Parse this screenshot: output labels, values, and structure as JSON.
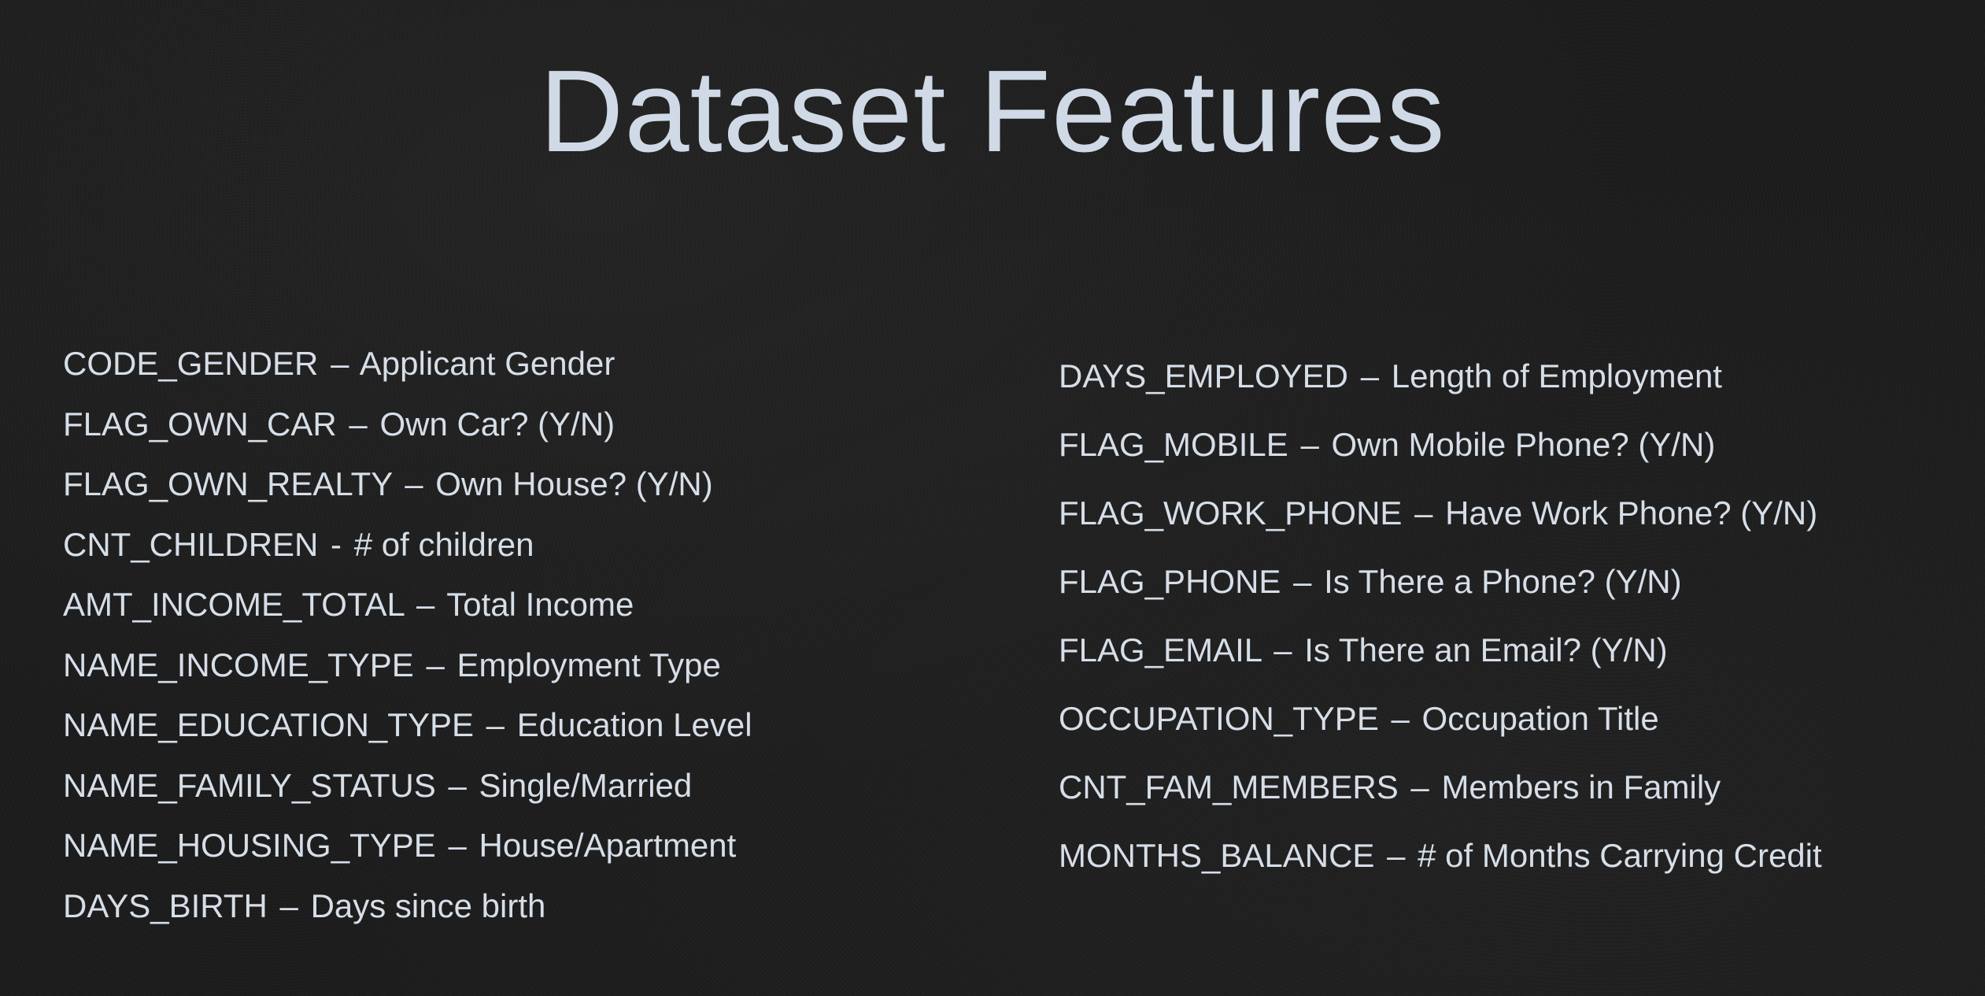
{
  "slide": {
    "title": "Dataset Features",
    "left_column": [
      {
        "field": "CODE_GENDER",
        "sep": "–",
        "desc": "Applicant Gender"
      },
      {
        "field": "FLAG_OWN_CAR",
        "sep": "–",
        "desc": "Own Car? (Y/N)"
      },
      {
        "field": "FLAG_OWN_REALTY",
        "sep": "–",
        "desc": "Own House? (Y/N)"
      },
      {
        "field": "CNT_CHILDREN",
        "sep": "-",
        "desc": "# of children"
      },
      {
        "field": "AMT_INCOME_TOTAL",
        "sep": "–",
        "desc": "Total Income"
      },
      {
        "field": "NAME_INCOME_TYPE",
        "sep": "–",
        "desc": "Employment Type"
      },
      {
        "field": "NAME_EDUCATION_TYPE",
        "sep": "–",
        "desc": "Education Level"
      },
      {
        "field": "NAME_FAMILY_STATUS",
        "sep": "–",
        "desc": "Single/Married"
      },
      {
        "field": "NAME_HOUSING_TYPE",
        "sep": "–",
        "desc": "House/Apartment"
      },
      {
        "field": "DAYS_BIRTH",
        "sep": "–",
        "desc": "Days since birth"
      }
    ],
    "right_column": [
      {
        "field": "DAYS_EMPLOYED",
        "sep": "–",
        "desc": "Length of Employment"
      },
      {
        "field": "FLAG_MOBILE",
        "sep": "–",
        "desc": "Own Mobile Phone? (Y/N)"
      },
      {
        "field": "FLAG_WORK_PHONE",
        "sep": "–",
        "desc": "Have Work Phone? (Y/N)"
      },
      {
        "field": "FLAG_PHONE",
        "sep": "–",
        "desc": "Is There a Phone? (Y/N)"
      },
      {
        "field": "FLAG_EMAIL",
        "sep": "–",
        "desc": "Is There an Email? (Y/N)"
      },
      {
        "field": "OCCUPATION_TYPE",
        "sep": "–",
        "desc": "Occupation Title"
      },
      {
        "field": "CNT_FAM_MEMBERS",
        "sep": "–",
        "desc": "Members in Family"
      },
      {
        "field": "MONTHS_BALANCE",
        "sep": "–",
        "desc": "# of Months Carrying Credit"
      }
    ]
  }
}
